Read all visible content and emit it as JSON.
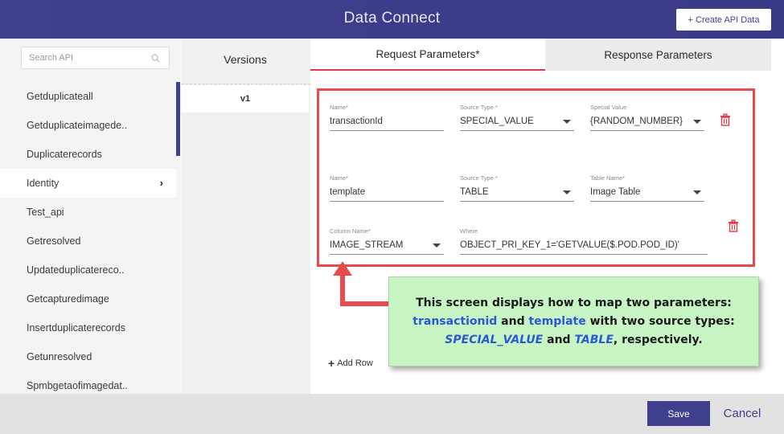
{
  "header": {
    "title": "Data Connect",
    "create_button": "+ Create API Data"
  },
  "search": {
    "placeholder": "Search API"
  },
  "api_list": [
    "Getduplicateall",
    "Getduplicateimagede..",
    "Duplicaterecords",
    "Identity",
    "Test_api",
    "Getresolved",
    "Updateduplicatereco..",
    "Getcapturedimage",
    "Insertduplicaterecords",
    "Getunresolved",
    "Spmbgetaofimagedat.."
  ],
  "active_api": "Identity",
  "versions": {
    "heading": "Versions",
    "items": [
      "v1"
    ]
  },
  "tabs": {
    "request": "Request Parameters*",
    "response": "Response Parameters"
  },
  "params": {
    "row1": {
      "name_label": "Name*",
      "name_value": "transactionId",
      "source_label": "Source Type *",
      "source_value": "SPECIAL_VALUE",
      "special_label": "Special Value",
      "special_value": "{RANDOM_NUMBER}"
    },
    "row2": {
      "name_label": "Name*",
      "name_value": "template",
      "source_label": "Source Type *",
      "source_value": "TABLE",
      "table_label": "Table Name*",
      "table_value": "Image Table"
    },
    "row3": {
      "column_label": "Column Name*",
      "column_value": "IMAGE_STREAM",
      "where_label": "Where",
      "where_value": "OBJECT_PRI_KEY_1='GETVALUE($.POD.POD_ID)'"
    }
  },
  "add_row": "Add Row",
  "callout": {
    "line1": "This screen displays how to map two parameters:",
    "line2_a": "transactionid",
    "line2_b": " and ",
    "line2_c": "template",
    "line2_d": " with two source types:",
    "line3_a": "SPECIAL_VALUE",
    "line3_b": " and ",
    "line3_c": "TABLE",
    "line3_d": ", respectively."
  },
  "footer": {
    "save": "Save",
    "cancel": "Cancel"
  },
  "colors": {
    "brand": "#3f3f8e",
    "accent_red": "#e64c4c",
    "callout_bg": "#c8f5c4",
    "callout_blue": "#2b58d6"
  }
}
